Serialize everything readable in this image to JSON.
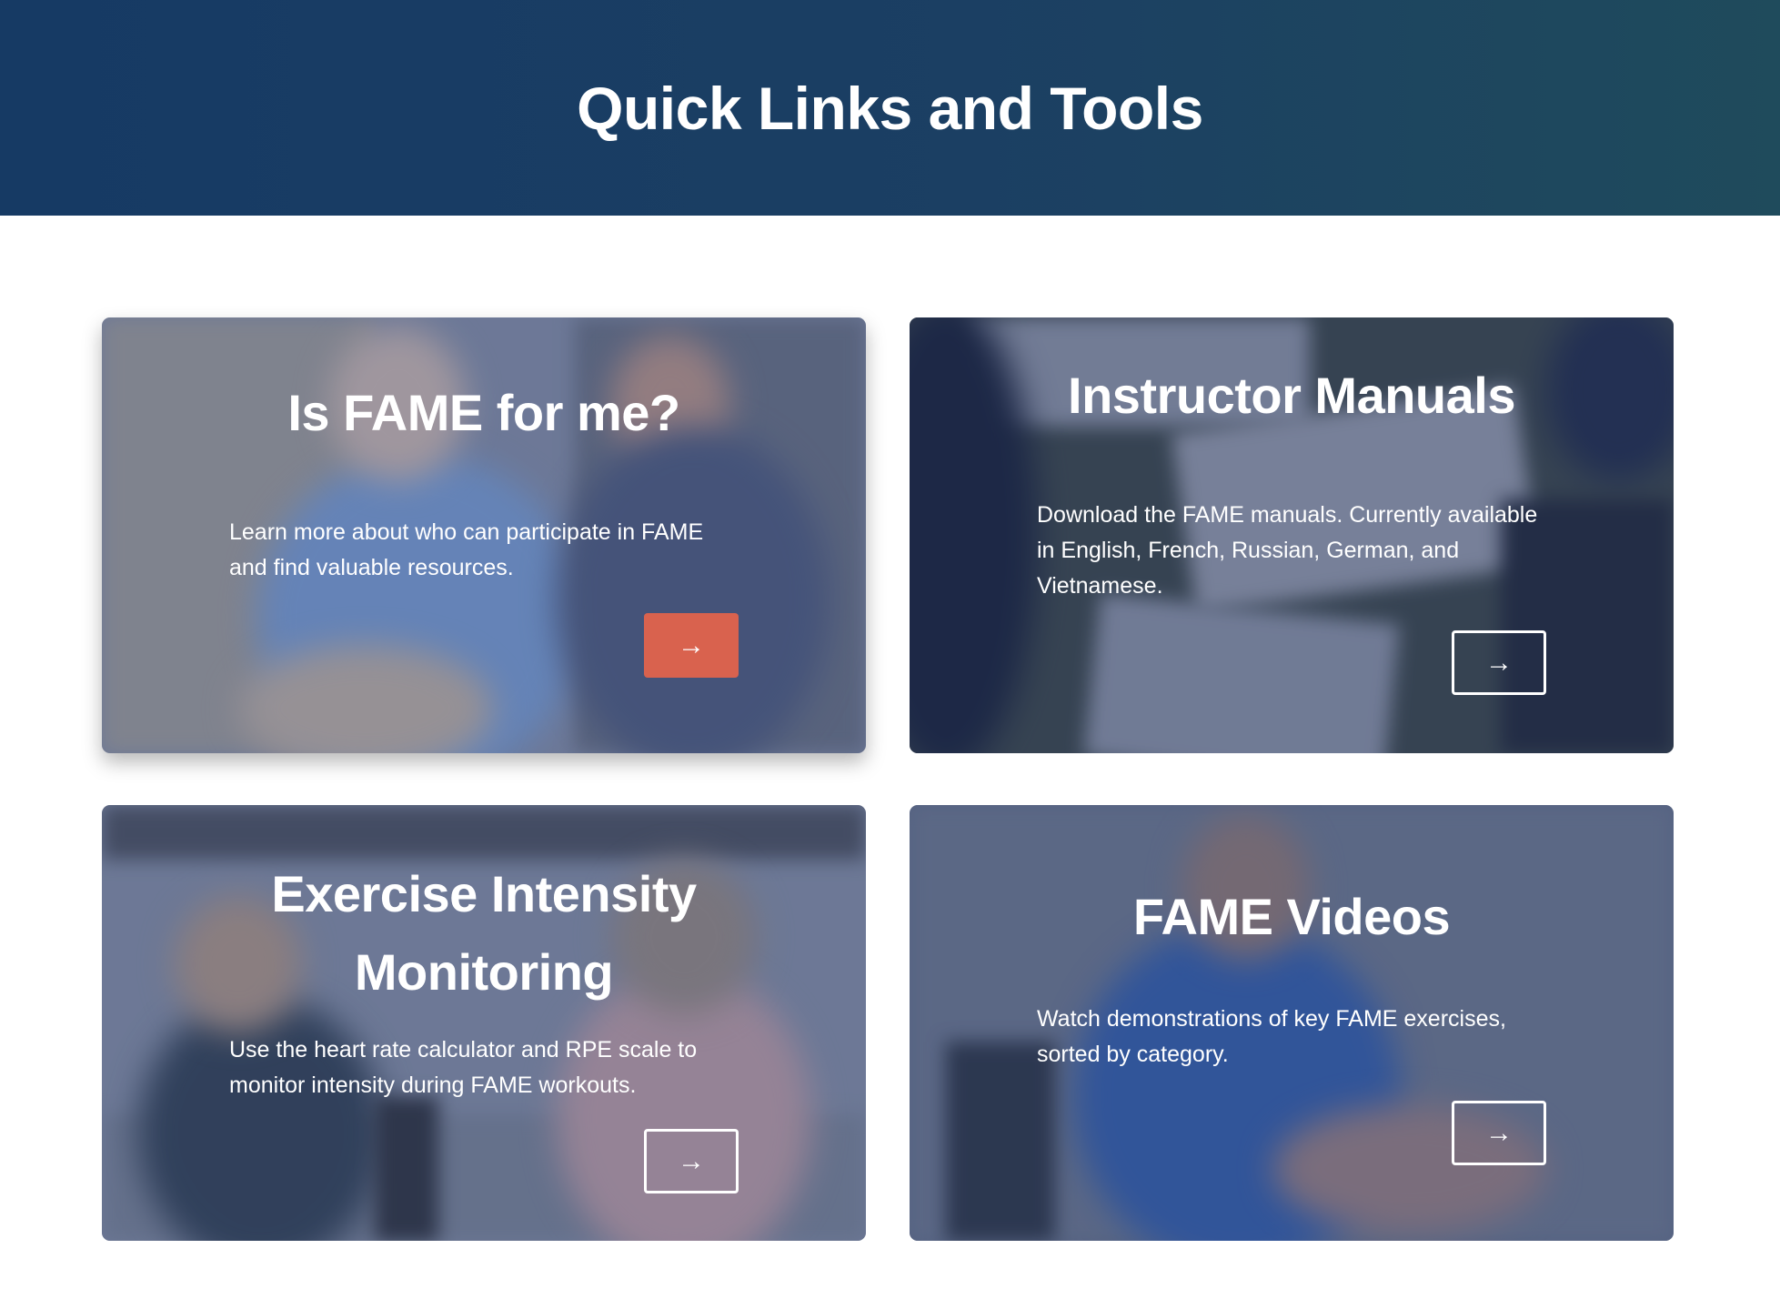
{
  "header": {
    "title": "Quick Links and Tools"
  },
  "cards": [
    {
      "title": "Is FAME for me?",
      "description": "Learn more about who can participate in FAME and find valuable resources.",
      "button_icon": "→"
    },
    {
      "title": "Instructor Manuals",
      "description": "Download the FAME manuals. Currently available in English, French, Russian, German, and Vietnamese.",
      "button_icon": "→"
    },
    {
      "title": "Exercise Intensity Monitoring",
      "description": "Use the heart rate calculator and RPE scale to monitor intensity during FAME workouts.",
      "button_icon": "→"
    },
    {
      "title": "FAME Videos",
      "description": "Watch demonstrations of key FAME exercises, sorted by category.",
      "button_icon": "→"
    }
  ],
  "colors": {
    "header_start": "#163a64",
    "header_end": "#1f4b5c",
    "accent_button": "#d9624e",
    "card_overlay": "#2b3d66"
  },
  "icons": {
    "arrow": "arrow-right-icon"
  }
}
